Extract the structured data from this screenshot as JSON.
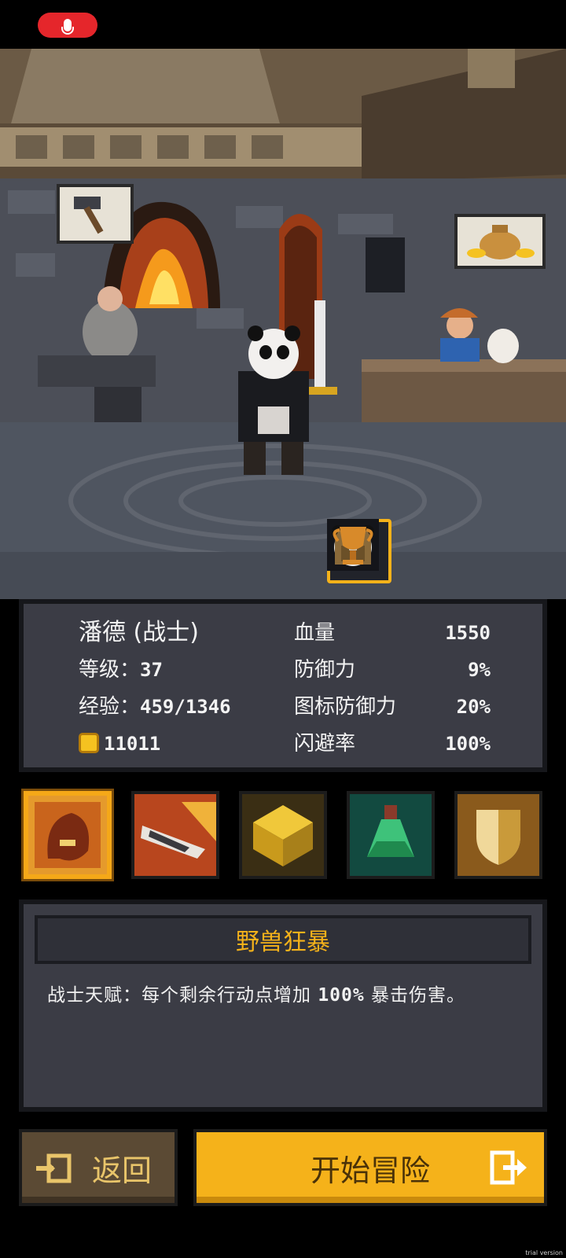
{
  "status_bar": {
    "record_icon": "microphone-icon",
    "record_color": "#e5262b"
  },
  "scene": {
    "blacksmith_bubble_icon": "hammer-icon",
    "merchant_bubble_icon": "money-sack-icon"
  },
  "tabs": [
    {
      "name": "character",
      "icon": "panda-portrait-icon",
      "active": true
    },
    {
      "name": "inventory",
      "icon": "backpack-icon",
      "active": false
    },
    {
      "name": "trophies",
      "icon": "trophy-icon",
      "active": false
    }
  ],
  "character": {
    "name_line": "潘德 (战士)",
    "level_label": "等级：",
    "level_value": "37",
    "exp_label": "经验：",
    "exp_value": "459/1346",
    "gold_value": "11011"
  },
  "stats": [
    {
      "label": "血量",
      "value": "1550"
    },
    {
      "label": "防御力",
      "value": "9%"
    },
    {
      "label": "图标防御力",
      "value": "20%"
    },
    {
      "label": "闪避率",
      "value": "100%"
    }
  ],
  "skills": [
    {
      "icon": "beast-rage-icon",
      "selected": true
    },
    {
      "icon": "blade-strike-icon",
      "selected": false
    },
    {
      "icon": "golden-chest-icon",
      "selected": false
    },
    {
      "icon": "green-potion-icon",
      "selected": false
    },
    {
      "icon": "shield-icon",
      "selected": false
    }
  ],
  "skill_detail": {
    "title": "野兽狂暴",
    "text_prefix": "战士天赋：每个剩余行动点增加 ",
    "text_value": "100%",
    "text_suffix": " 暴击伤害。"
  },
  "buttons": {
    "back_label": "返回",
    "start_label": "开始冒险"
  },
  "colors": {
    "accent": "#f5b21a",
    "panel": "#3b3c45",
    "back_button": "#5b4a34"
  },
  "watermark": "trial version"
}
